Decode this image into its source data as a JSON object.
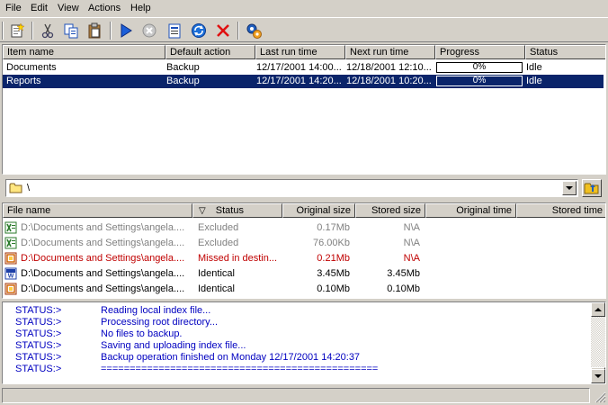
{
  "menu": [
    "File",
    "Edit",
    "View",
    "Actions",
    "Help"
  ],
  "toolbar_icons": [
    "new-item-icon",
    "cut-icon",
    "copy-icon",
    "paste-icon",
    "run-icon",
    "stop-icon",
    "properties-icon",
    "sync-icon",
    "delete-icon",
    "settings-icon"
  ],
  "jobs": {
    "columns": [
      "Item name",
      "Default action",
      "Last run time",
      "Next run time",
      "Progress",
      "Status"
    ],
    "rows": [
      {
        "name": "Documents",
        "action": "Backup",
        "last": "12/17/2001 14:00...",
        "next": "12/18/2001 12:10...",
        "progress": "0%",
        "status": "Idle",
        "selected": false
      },
      {
        "name": "Reports",
        "action": "Backup",
        "last": "12/17/2001 14:20...",
        "next": "12/18/2001 10:20...",
        "progress": "0%",
        "status": "Idle",
        "selected": true
      }
    ]
  },
  "path": {
    "value": "\\"
  },
  "files": {
    "columns": [
      "File name",
      "Status",
      "Original size",
      "Stored size",
      "Original time",
      "Stored time"
    ],
    "sort_indicator": "▽",
    "rows": [
      {
        "name": "D:\\Documents and Settings\\angela....",
        "status": "Excluded",
        "orig": "0.17Mb",
        "stored": "N\\A",
        "icon": "excel-file-icon",
        "color": "#808080"
      },
      {
        "name": "D:\\Documents and Settings\\angela....",
        "status": "Excluded",
        "orig": "76.00Kb",
        "stored": "N\\A",
        "icon": "excel-file-icon",
        "color": "#808080"
      },
      {
        "name": "D:\\Documents and Settings\\angela....",
        "status": "Missed in destin...",
        "orig": "0.21Mb",
        "stored": "N\\A",
        "icon": "access-file-icon",
        "color": "#c00000"
      },
      {
        "name": "D:\\Documents and Settings\\angela....",
        "status": "Identical",
        "orig": "3.45Mb",
        "stored": "3.45Mb",
        "icon": "word-file-icon",
        "color": "#000000"
      },
      {
        "name": "D:\\Documents and Settings\\angela....",
        "status": "Identical",
        "orig": "0.10Mb",
        "stored": "0.10Mb",
        "icon": "access-file-icon",
        "color": "#000000"
      }
    ]
  },
  "log": [
    {
      "label": "STATUS:>",
      "msg": "Reading local index file..."
    },
    {
      "label": "STATUS:>",
      "msg": "Processing root directory..."
    },
    {
      "label": "STATUS:>",
      "msg": "No files to backup."
    },
    {
      "label": "STATUS:>",
      "msg": "Saving and uploading index file..."
    },
    {
      "label": "STATUS:>",
      "msg": "Backup operation finished on Monday 12/17/2001 14:20:37"
    },
    {
      "label": "STATUS:>",
      "msg": "================================================"
    }
  ],
  "colors": {
    "selection": "#0a246a",
    "log_text": "#0000c0",
    "missed": "#c00000",
    "excluded": "#808080",
    "face": "#d4d0c8"
  }
}
